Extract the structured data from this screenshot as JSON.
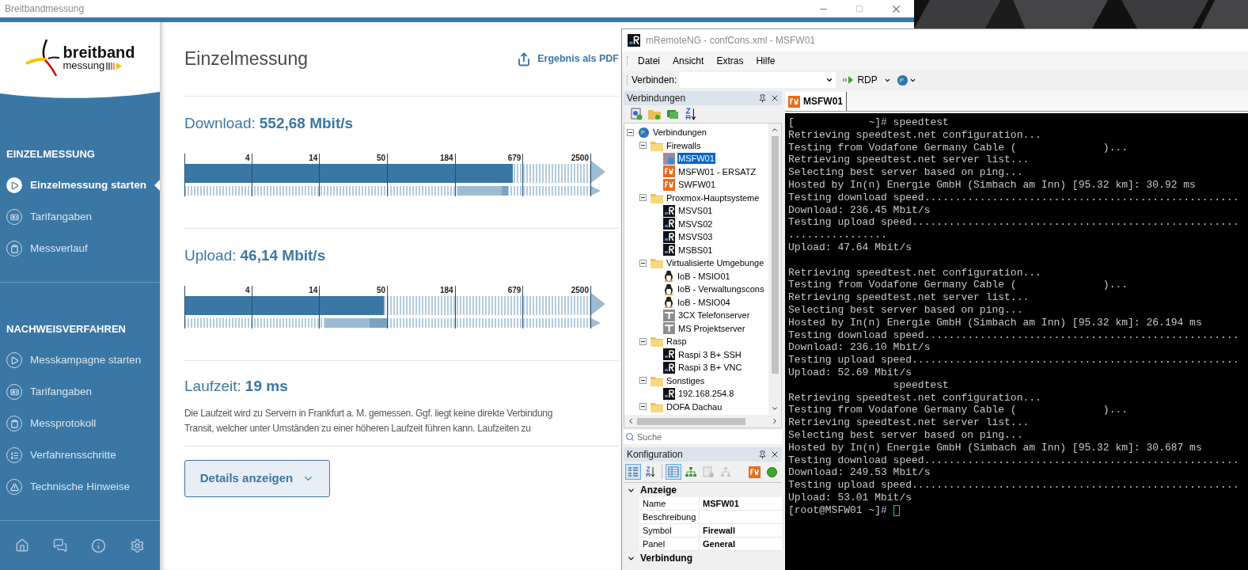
{
  "breitband": {
    "window_title": "Breitbandmessung",
    "logo": {
      "word_top": "breitband",
      "word_bottom": "messung"
    },
    "sidebar": [
      {
        "heading": "EINZELMESSUNG",
        "items": [
          {
            "label": "Einzelmessung starten",
            "kind": "start",
            "selected": true
          },
          {
            "label": "Tarifangaben",
            "kind": "tariff",
            "selected": false
          },
          {
            "label": "Messverlauf",
            "kind": "log",
            "selected": false
          }
        ]
      },
      {
        "heading": "NACHWEISVERFAHREN",
        "items": [
          {
            "label": "Messkampagne starten",
            "kind": "start",
            "selected": false
          },
          {
            "label": "Tarifangaben",
            "kind": "tariff",
            "selected": false
          },
          {
            "label": "Messprotokoll",
            "kind": "log",
            "selected": false
          },
          {
            "label": "Verfahrensschritte",
            "kind": "steps",
            "selected": false
          },
          {
            "label": "Technische Hinweise",
            "kind": "warning",
            "selected": false
          }
        ]
      }
    ],
    "page_title": "Einzelmessung",
    "export_link": "Ergebnis als PDF",
    "measurements": [
      {
        "label": "Download:",
        "value": "552,68 Mbit/s",
        "gauge": {
          "level": 0.807,
          "ticks": [
            "4",
            "14",
            "50",
            "184",
            "679",
            "2500"
          ],
          "tariff": {
            "low": {
              "level": 0.674
            },
            "typical": {
              "level": 0.78
            },
            "high": {
              "level": 0.796
            }
          }
        }
      },
      {
        "label": "Upload:",
        "value": "46,14 Mbit/s",
        "gauge": {
          "level": 0.49,
          "ticks": [
            "4",
            "14",
            "50",
            "184",
            "679",
            "2500"
          ],
          "tariff": {
            "low": {
              "level": 0.346
            },
            "typical": {
              "level": 0.455
            },
            "high": {
              "level": 0.5
            }
          }
        }
      }
    ],
    "latency": {
      "label": "Laufzeit:",
      "value": "19 ms",
      "note_lines": [
        "Die Laufzeit wird zu Servern in Frankfurt a. M. gemessen. Ggf. liegt keine direkte Verbindung",
        "Transit, welcher unter Umständen zu einer höheren Laufzeit führen kann. Laufzeiten zu"
      ]
    },
    "details_button": "Details anzeigen"
  },
  "mremoteng": {
    "window_title": "mRemoteNG - confCons.xml - MSFW01",
    "menu": [
      "Datei",
      "Ansicht",
      "Extras",
      "Hilfe"
    ],
    "toolbar": {
      "connect_label": "Verbinden:",
      "protocol": "RDP"
    },
    "connections_panel": {
      "title": "Verbindungen",
      "tree": [
        {
          "label": "Verbindungen",
          "kind": "globe",
          "expanded": true,
          "selected": false,
          "children": [
            {
              "label": "Firewalls",
              "kind": "folder",
              "expanded": true,
              "selected": false,
              "children": [
                {
                  "label": "MSFW01",
                  "kind": "fw-connected",
                  "selected": true
                },
                {
                  "label": "MSFW01 - ERSATZ",
                  "kind": "fw",
                  "selected": false
                },
                {
                  "label": "SWFW01",
                  "kind": "fw",
                  "selected": false
                }
              ]
            },
            {
              "label": "Proxmox-Hauptsysteme",
              "kind": "folder",
              "expanded": true,
              "selected": false,
              "children": [
                {
                  "label": "MSVS01",
                  "kind": "terminal",
                  "selected": false
                },
                {
                  "label": "MSVS02",
                  "kind": "terminal",
                  "selected": false
                },
                {
                  "label": "MSVS03",
                  "kind": "terminal",
                  "selected": false
                },
                {
                  "label": "MSBS01",
                  "kind": "terminal",
                  "selected": false
                }
              ]
            },
            {
              "label": "Virtualisierte Umgebunge",
              "kind": "folder",
              "expanded": true,
              "selected": false,
              "children": [
                {
                  "label": "IoB - MSIO01",
                  "kind": "linux",
                  "selected": false
                },
                {
                  "label": "IoB - Verwaltungscons",
                  "kind": "linux",
                  "selected": false
                },
                {
                  "label": "IoB - MSIO04",
                  "kind": "linux",
                  "selected": false
                },
                {
                  "label": "3CX Telefonserver",
                  "kind": "tel",
                  "selected": false
                },
                {
                  "label": "MS Projektserver",
                  "kind": "tel",
                  "selected": false
                }
              ]
            },
            {
              "label": "Rasp",
              "kind": "folder",
              "expanded": true,
              "selected": false,
              "children": [
                {
                  "label": "Raspi 3 B+ SSH",
                  "kind": "terminal",
                  "selected": false
                },
                {
                  "label": "Raspi 3 B+ VNC",
                  "kind": "terminal",
                  "selected": false
                }
              ]
            },
            {
              "label": "Sonstiges",
              "kind": "folder",
              "expanded": true,
              "selected": false,
              "children": [
                {
                  "label": "192.168.254.8",
                  "kind": "terminal",
                  "selected": false
                }
              ]
            },
            {
              "label": "DOFA Dachau",
              "kind": "folder",
              "expanded": true,
              "selected": false
            }
          ]
        }
      ],
      "search_placeholder": "Suche"
    },
    "config_panel": {
      "title": "Konfiguration",
      "buttons": [
        {
          "kind": "categorized",
          "selected": true,
          "disabled": false
        },
        {
          "kind": "alphabetical",
          "selected": false,
          "disabled": false
        },
        {
          "kind": "properties",
          "selected": true,
          "disabled": false
        },
        {
          "kind": "hierarchy",
          "selected": false,
          "disabled": false
        },
        {
          "kind": "defaults",
          "selected": false,
          "disabled": true
        },
        {
          "kind": "inheritance",
          "selected": false,
          "disabled": true
        },
        {
          "kind": "firewall",
          "selected": false,
          "disabled": false
        },
        {
          "kind": "status",
          "selected": false,
          "disabled": false
        }
      ],
      "categories": [
        {
          "name": "Anzeige",
          "expanded": true,
          "rows": [
            {
              "name": "Name",
              "value": "MSFW01"
            },
            {
              "name": "Beschreibung"
            },
            {
              "name": "Symbol",
              "value": "Firewall"
            },
            {
              "name": "Panel",
              "value": "General"
            }
          ]
        },
        {
          "name": "Verbindung",
          "expanded": true
        }
      ]
    },
    "tabs": [
      {
        "label": "MSFW01",
        "selected": true
      }
    ],
    "terminal": [
      {
        "text": "[            ~]# speedtest"
      },
      {
        "text": "Retrieving speedtest.net configuration..."
      },
      {
        "text": "Testing from Vodafone Germany Cable (              )..."
      },
      {
        "text": "Retrieving speedtest.net server list..."
      },
      {
        "text": "Selecting best server based on ping..."
      },
      {
        "text": "Hosted by In(n) Energie GmbH (Simbach am Inn) [95.32 km]: 30.92 ms"
      },
      {
        "text": "Testing download speed..................................................."
      },
      {
        "text": "Download: 236.45 Mbit/s"
      },
      {
        "text": "Testing upload speed....................................................."
      },
      {
        "text": "................"
      },
      {
        "text": "Upload: 47.64 Mbit/s"
      },
      {
        "text": "Retrieving speedtest.net configuration...",
        "gap_before": true
      },
      {
        "text": "Testing from Vodafone Germany Cable (              )..."
      },
      {
        "text": "Retrieving speedtest.net server list..."
      },
      {
        "text": "Selecting best server based on ping..."
      },
      {
        "text": "Hosted by In(n) Energie GmbH (Simbach am Inn) [95.32 km]: 26.194 ms"
      },
      {
        "text": "Testing download speed..................................................."
      },
      {
        "text": "Download: 236.10 Mbit/s"
      },
      {
        "text": "Testing upload speed....................................................."
      },
      {
        "text": "Upload: 52.69 Mbit/s"
      },
      {
        "text": "                 speedtest"
      },
      {
        "text": "Retrieving speedtest.net configuration..."
      },
      {
        "text": "Testing from Vodafone Germany Cable (              )..."
      },
      {
        "text": "Retrieving speedtest.net server list..."
      },
      {
        "text": "Selecting best server based on ping..."
      },
      {
        "text": "Hosted by In(n) Energie GmbH (Simbach am Inn) [95.32 km]: 30.687 ms"
      },
      {
        "text": "Testing download speed..................................................."
      },
      {
        "text": "Download: 249.53 Mbit/s"
      },
      {
        "text": "Testing upload speed....................................................."
      },
      {
        "text": "Upload: 53.01 Mbit/s"
      },
      {
        "text": "[root@MSFW01 ~]# ",
        "cursor": true
      }
    ]
  }
}
